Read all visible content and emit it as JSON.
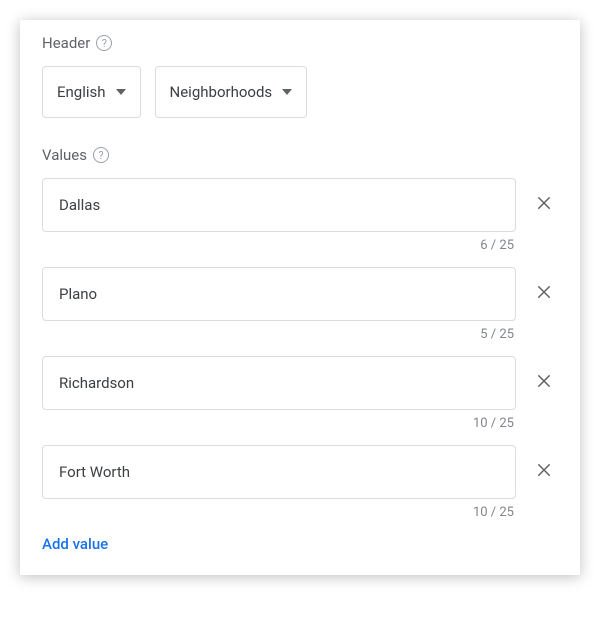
{
  "header": {
    "label": "Header",
    "language_dropdown": "English",
    "type_dropdown": "Neighborhoods"
  },
  "values": {
    "label": "Values",
    "max_chars": 25,
    "items": [
      {
        "text": "Dallas",
        "count": "6 / 25"
      },
      {
        "text": "Plano",
        "count": "5 / 25"
      },
      {
        "text": "Richardson",
        "count": "10 / 25"
      },
      {
        "text": "Fort Worth",
        "count": "10 / 25"
      }
    ],
    "add_label": "Add value"
  }
}
